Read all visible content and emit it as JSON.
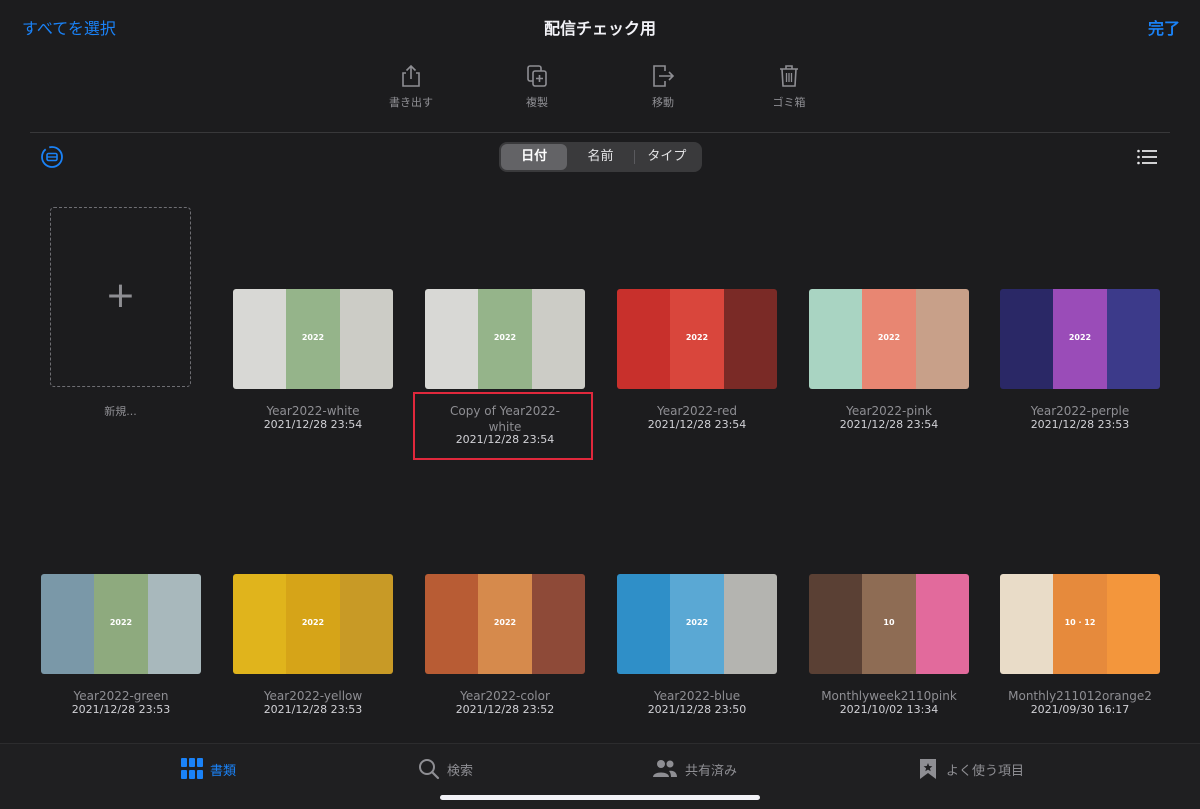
{
  "nav": {
    "select_all": "すべてを選択",
    "title": "配信チェック用",
    "done": "完了"
  },
  "toolbar": [
    {
      "label": "書き出す",
      "icon": "share-icon"
    },
    {
      "label": "複製",
      "icon": "duplicate-icon"
    },
    {
      "label": "移動",
      "icon": "move-icon"
    },
    {
      "label": "ゴミ箱",
      "icon": "trash-icon"
    }
  ],
  "sort": {
    "options": [
      "日付",
      "名前",
      "タイプ"
    ],
    "selected": "日付"
  },
  "new_document": {
    "label": "新規..."
  },
  "documents": [
    {
      "name": "Year2022-white",
      "date": "2021/12/28 23:54",
      "colors": [
        "#d8d8d5",
        "#95b48a",
        "#ccccc6"
      ],
      "year": "2022"
    },
    {
      "name": "Copy of Year2022-white",
      "date": "2021/12/28 23:54",
      "colors": [
        "#d8d8d5",
        "#95b48a",
        "#ccccc6"
      ],
      "year": "2022"
    },
    {
      "name": "Year2022-red",
      "date": "2021/12/28 23:54",
      "colors": [
        "#c8302c",
        "#d9463c",
        "#7a2a26"
      ],
      "year": "2022"
    },
    {
      "name": "Year2022-pink",
      "date": "2021/12/28 23:54",
      "colors": [
        "#a9d4c2",
        "#e88672",
        "#c8a089"
      ],
      "year": "2022"
    },
    {
      "name": "Year2022-perple",
      "date": "2021/12/28 23:53",
      "colors": [
        "#2a2866",
        "#9a4cb8",
        "#3c3a8a"
      ],
      "year": "2022"
    },
    {
      "name": "Year2022-green",
      "date": "2021/12/28 23:53",
      "colors": [
        "#7a98a8",
        "#8eaa7e",
        "#a8b8bc"
      ],
      "year": "2022"
    },
    {
      "name": "Year2022-yellow",
      "date": "2021/12/28 23:53",
      "colors": [
        "#e0b41c",
        "#d6a418",
        "#c89a26"
      ],
      "year": "2022"
    },
    {
      "name": "Year2022-color",
      "date": "2021/12/28 23:52",
      "colors": [
        "#b85c34",
        "#d68a4c",
        "#8e4a38"
      ],
      "year": "2022"
    },
    {
      "name": "Year2022-blue",
      "date": "2021/12/28 23:50",
      "colors": [
        "#2f8fc8",
        "#5aa8d4",
        "#b4b4b0"
      ],
      "year": "2022"
    },
    {
      "name": "Monthlyweek2110pink",
      "date": "2021/10/02 13:34",
      "colors": [
        "#5a4034",
        "#8e6c54",
        "#e26a9c"
      ],
      "year": "10"
    },
    {
      "name": "Monthly211012orange2",
      "date": "2021/09/30 16:17",
      "colors": [
        "#e9dcc8",
        "#e68a3c",
        "#f3963c"
      ],
      "year": "10 · 12"
    }
  ],
  "tabs": [
    {
      "label": "書類",
      "icon": "grid-icon",
      "active": true
    },
    {
      "label": "検索",
      "icon": "search-icon",
      "active": false
    },
    {
      "label": "共有済み",
      "icon": "people-icon",
      "active": false
    },
    {
      "label": "よく使う項目",
      "icon": "bookmark-icon",
      "active": false
    }
  ],
  "colors": {
    "accent": "#1a82f7",
    "background": "#1c1c1e",
    "highlight": "#e0283c"
  }
}
